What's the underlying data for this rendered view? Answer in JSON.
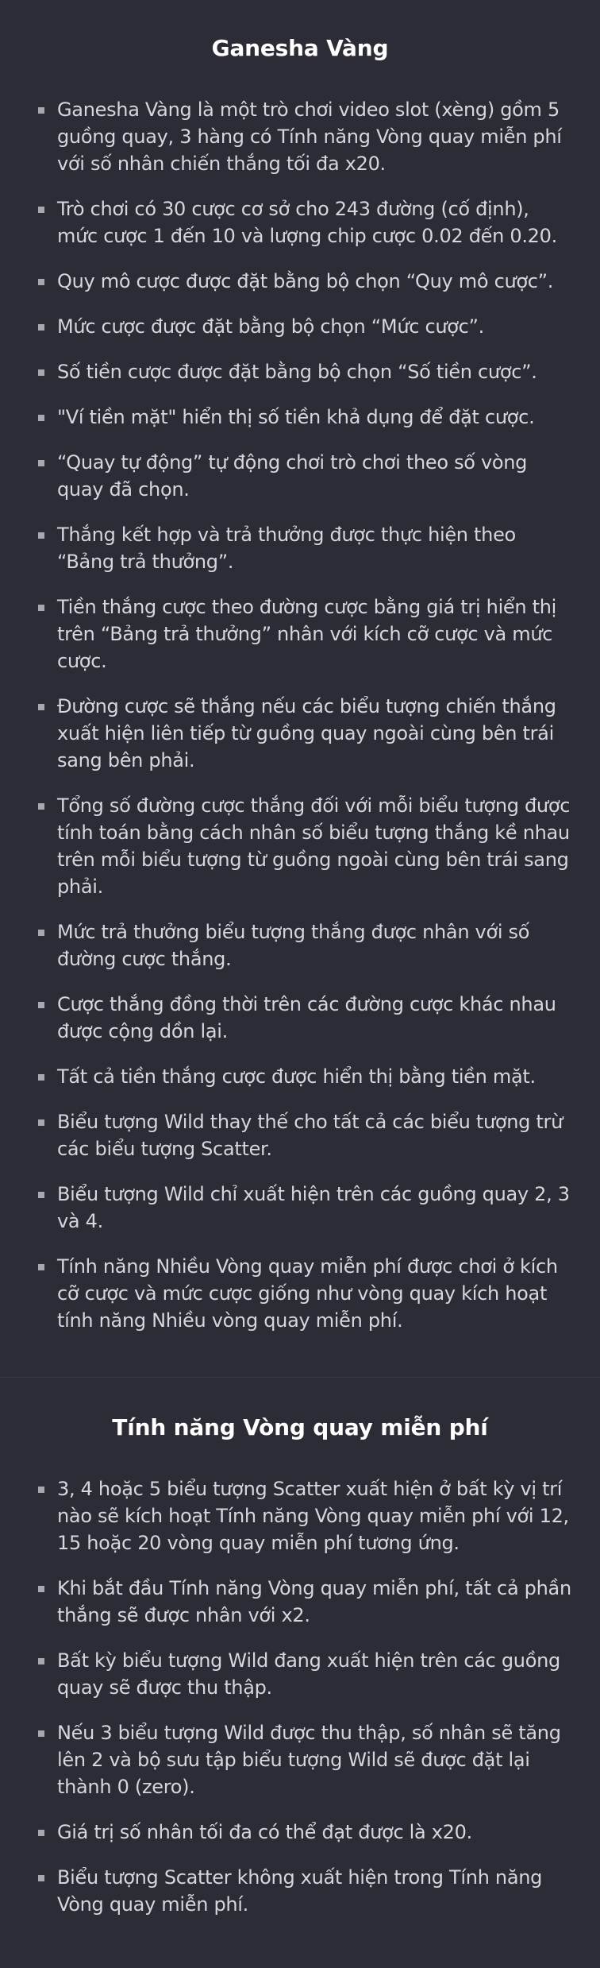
{
  "sections": [
    {
      "title": "Ganesha Vàng",
      "items": [
        "Ganesha Vàng là một trò chơi video slot (xèng) gồm 5 guồng quay, 3 hàng có Tính năng Vòng quay miễn phí với số nhân chiến thắng tối đa x20.",
        "Trò chơi có 30 cược cơ sở cho 243 đường (cố định), mức cược 1 đến 10 và lượng chip cược 0.02 đến 0.20.",
        "Quy mô cược được đặt bằng bộ chọn “Quy mô cược”.",
        "Mức cược được đặt bằng bộ chọn “Mức cược”.",
        "Số tiền cược được đặt bằng bộ chọn “Số tiền cược”.",
        "\"Ví tiền mặt\" hiển thị số tiền khả dụng để đặt cược.",
        "“Quay tự động” tự động chơi trò chơi theo số vòng quay đã chọn.",
        "Thắng kết hợp và trả thưởng được thực hiện theo “Bảng trả thưởng”.",
        "Tiền thắng cược theo đường cược bằng giá trị hiển thị trên “Bảng trả thưởng” nhân với kích cỡ cược và mức cược.",
        "Đường cược sẽ thắng nếu các biểu tượng chiến thắng xuất hiện liên tiếp từ guồng quay ngoài cùng bên trái sang bên phải.",
        "Tổng số đường cược thắng đối với mỗi biểu tượng được tính toán bằng cách nhân số biểu tượng thắng kề nhau trên mỗi biểu tượng từ guồng ngoài cùng bên trái sang phải.",
        "Mức trả thưởng biểu tượng thắng được nhân với số đường cược thắng.",
        "Cược thắng đồng thời trên các đường cược khác nhau được cộng dồn lại.",
        "Tất cả tiền thắng cược được hiển thị bằng tiền mặt.",
        "Biểu tượng Wild thay thế cho tất cả các biểu tượng trừ các biểu tượng Scatter.",
        "Biểu tượng Wild chỉ xuất hiện trên các guồng quay 2, 3 và 4.",
        "Tính năng Nhiều Vòng quay miễn phí được chơi ở kích cỡ cược và mức cược giống như vòng quay kích hoạt tính năng Nhiều vòng quay miễn phí."
      ]
    },
    {
      "title": "Tính năng Vòng quay miễn phí",
      "items": [
        "3, 4 hoặc 5 biểu tượng Scatter xuất hiện ở bất kỳ vị trí nào sẽ kích hoạt Tính năng Vòng quay miễn phí với 12, 15 hoặc 20 vòng quay miễn phí tương ứng.",
        "Khi bắt đầu Tính năng Vòng quay miễn phí, tất cả phần thắng sẽ được nhân với x2.",
        "Bất kỳ biểu tượng Wild đang xuất hiện trên các guồng quay sẽ được thu thập.",
        "Nếu 3 biểu tượng Wild được thu thập, số nhân sẽ tăng lên 2 và bộ sưu tập biểu tượng Wild sẽ được đặt lại thành 0 (zero).",
        "Giá trị số nhân tối đa có thể đạt được là x20.",
        "Biểu tượng Scatter không xuất hiện trong Tính năng Vòng quay miễn phí."
      ]
    }
  ]
}
